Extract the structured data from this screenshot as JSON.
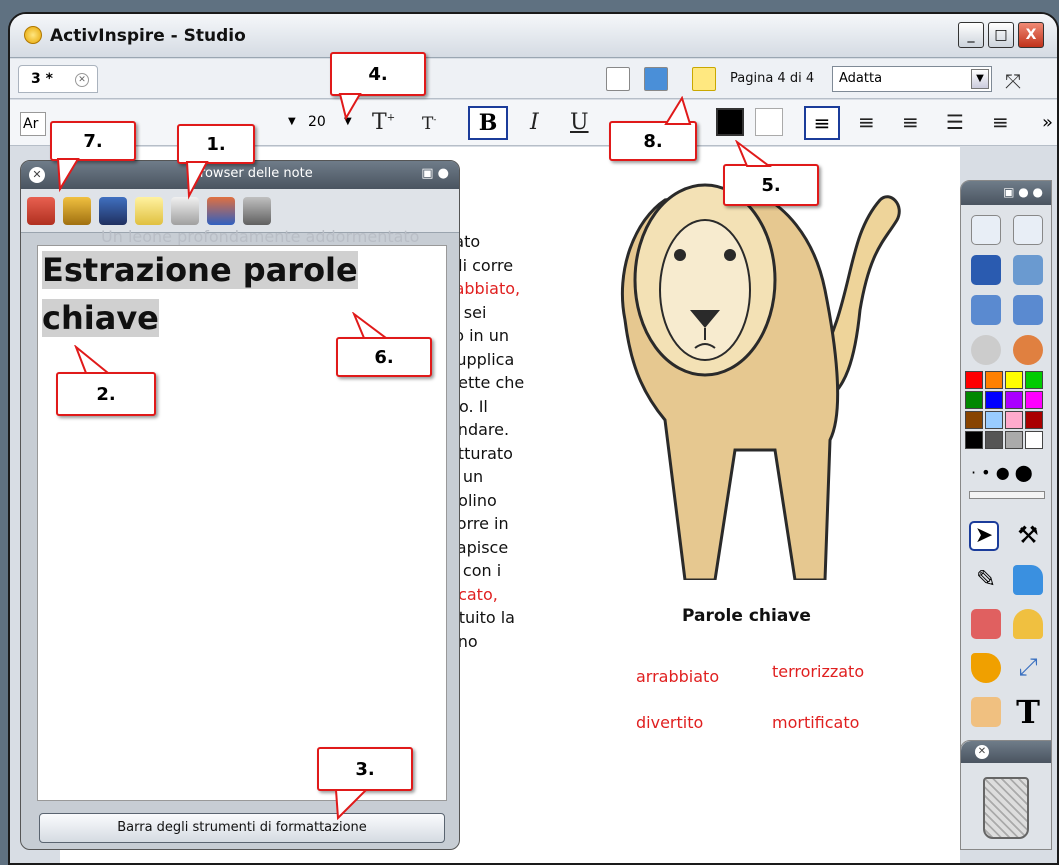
{
  "window": {
    "title": "ActivInspire - Studio",
    "minimize": "_",
    "maximize": "□",
    "close": "X"
  },
  "tabs": {
    "doc_tab": "3 *",
    "page_indicator": "Pagina 4 di 4",
    "zoom_value": "Adatta"
  },
  "format_toolbar": {
    "font_name": "Ar",
    "font_size": "20",
    "bold": "B",
    "italic": "I",
    "underline": "U"
  },
  "canvas": {
    "story_lines": [
      "tato",
      "gli corre",
      "rabbiato,",
      "ti sei",
      "rò in un",
      "supplica",
      "nette che",
      "rlo. Il",
      "andare.",
      "atturato",
      "a un",
      "polino",
      "corre in",
      "capisce",
      "e con i",
      "ficato,",
      "tituito la",
      "ono"
    ],
    "keywords_title": "Parole chiave",
    "keywords": [
      "arrabbiato",
      "terrorizzato",
      "divertito",
      "mortificato"
    ]
  },
  "notes_browser": {
    "title": "Browser delle note",
    "ghost_text": "Un leone profondamente addormentato",
    "heading_line1": "Estrazione parole",
    "heading_line2": "chiave",
    "format_button": "Barra degli strumenti di formattazione"
  },
  "callouts": [
    "1.",
    "2.",
    "3.",
    "4.",
    "5.",
    "6.",
    "7.",
    "8."
  ],
  "colors": {
    "accent": "#1b3c9a",
    "callout_border": "#e01a1a",
    "keyword": "#e02020"
  }
}
